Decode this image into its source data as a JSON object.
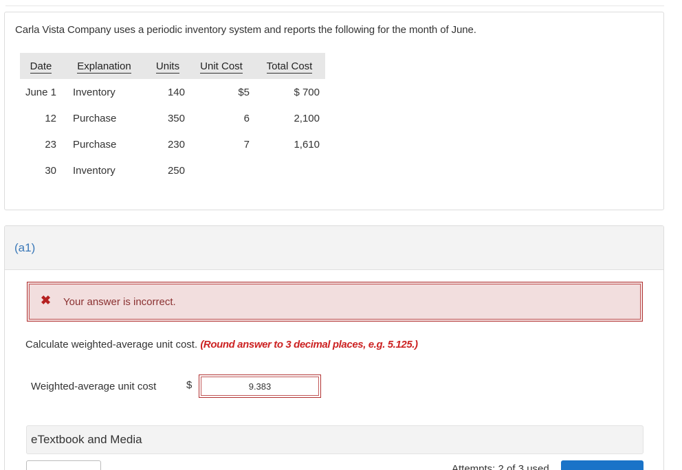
{
  "problem": {
    "text": "Carla Vista Company uses a periodic inventory system and reports the following for the month of June."
  },
  "table": {
    "headers": [
      "Date",
      "Explanation",
      "Units",
      "Unit Cost",
      "Total Cost"
    ],
    "rows": [
      [
        "June 1",
        "Inventory",
        "140",
        "$5",
        "$ 700"
      ],
      [
        "12",
        "Purchase",
        "350",
        "6",
        "2,100"
      ],
      [
        "23",
        "Purchase",
        "230",
        "7",
        "1,610"
      ],
      [
        "30",
        "Inventory",
        "250",
        "",
        ""
      ]
    ]
  },
  "part": {
    "label": "(a1)",
    "error_icon": "✖",
    "error_text": "Your answer is incorrect.",
    "instruction": "Calculate weighted-average unit cost.",
    "hint": "(Round answer to 3 decimal places, e.g. 5.125.)",
    "answer_label": "Weighted-average unit cost",
    "currency": "$",
    "answer_value": "9.383",
    "etextbook": "eTextbook and Media",
    "attempts": "Attempts: 2 of 3 used"
  }
}
